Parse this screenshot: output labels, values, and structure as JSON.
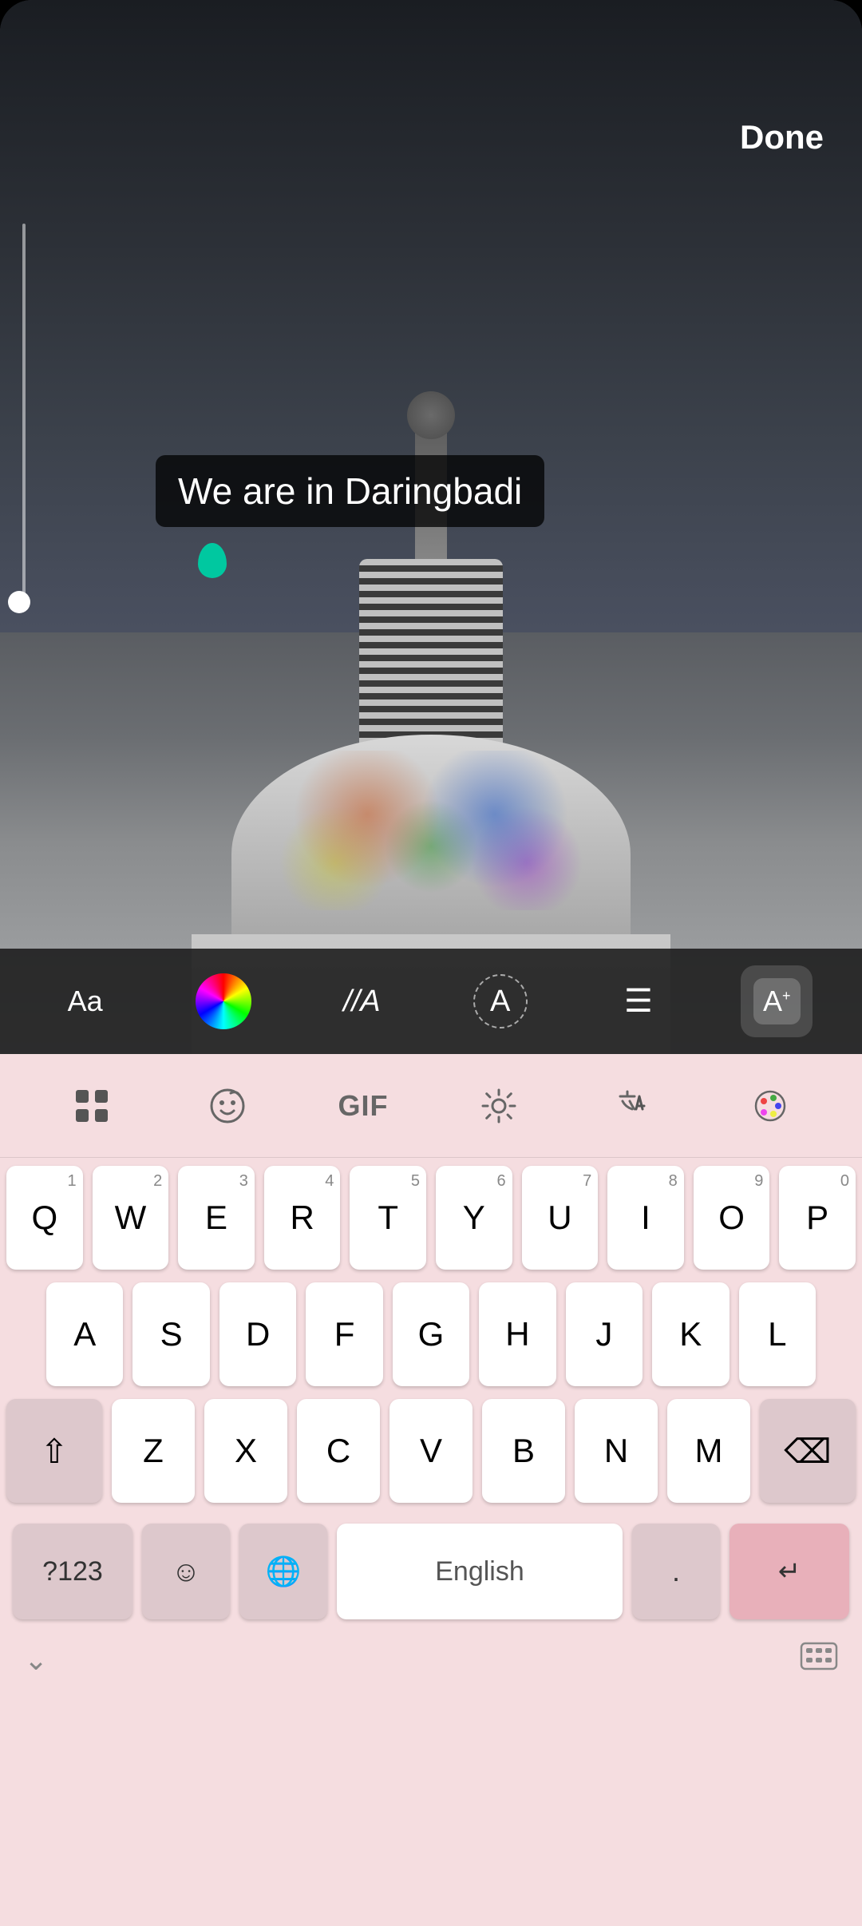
{
  "header": {
    "done_label": "Done"
  },
  "text_overlay": {
    "content": "We are in Daringbadi"
  },
  "toolbar": {
    "font_btn": "Aa",
    "font_style_btn": "//A",
    "text_effect_btn": "A✦",
    "align_btn": "≡",
    "auto_text_btn": "A+"
  },
  "keyboard_top": {
    "icons": [
      "apps",
      "sticker",
      "GIF",
      "settings",
      "translate",
      "palette"
    ]
  },
  "keyboard": {
    "rows": [
      [
        "Q",
        "W",
        "E",
        "R",
        "T",
        "Y",
        "U",
        "I",
        "O",
        "P"
      ],
      [
        "A",
        "S",
        "D",
        "F",
        "G",
        "H",
        "J",
        "K",
        "L"
      ],
      [
        "Z",
        "X",
        "C",
        "V",
        "B",
        "N",
        "M"
      ]
    ],
    "numbers": [
      "1",
      "2",
      "3",
      "4",
      "5",
      "6",
      "7",
      "8",
      "9",
      "0"
    ],
    "special_keys": {
      "shift": "⇧",
      "backspace": "⌫",
      "num_switch": "?123",
      "emoji": "☺",
      "globe": "🌐",
      "space": "English",
      "period": ".",
      "return": "↵"
    }
  },
  "colors": {
    "background": "#f5dde0",
    "key_bg": "#ffffff",
    "special_key_bg": "#ddc8cc",
    "action_key_bg": "#e8b0ba",
    "teal_dot": "#00c8a0"
  }
}
